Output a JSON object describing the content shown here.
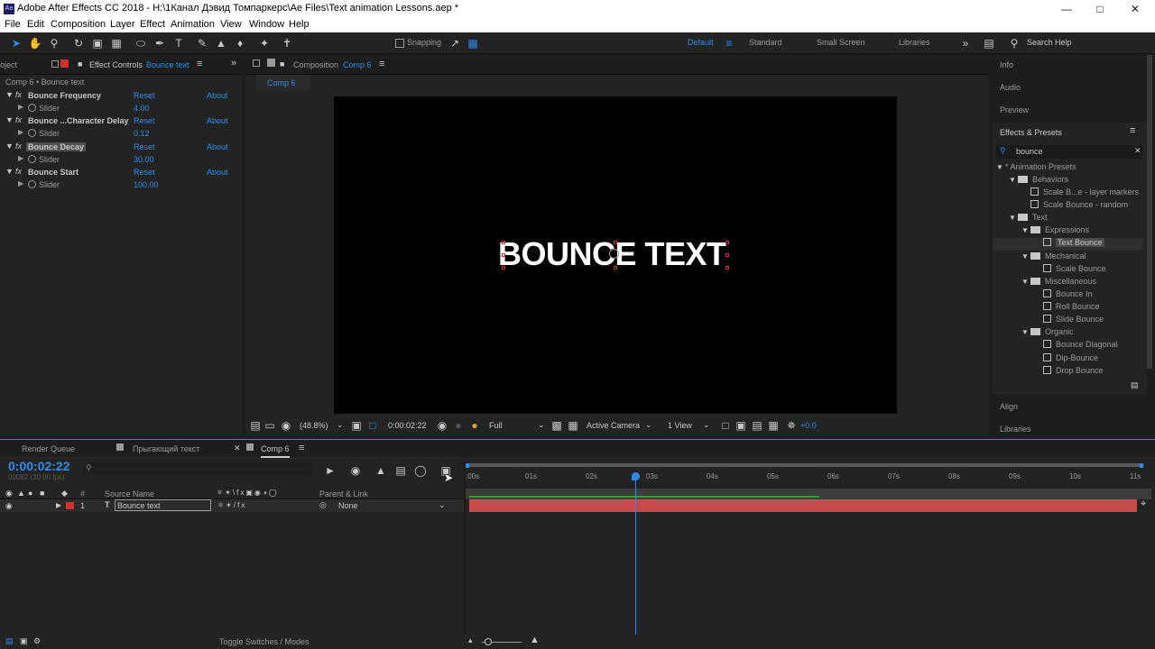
{
  "window": {
    "title": "Adobe After Effects CC 2018 - H:\\1Канал Дэвид Томпаркерс\\Ae Files\\Text animation Lessons.aep *",
    "app_icon": "Ae"
  },
  "menu": [
    "File",
    "Edit",
    "Composition",
    "Layer",
    "Effect",
    "Animation",
    "View",
    "Window",
    "Help"
  ],
  "toolbar": {
    "snapping_label": "Snapping",
    "workspaces": [
      "Default",
      "Standard",
      "Small Screen",
      "Libraries"
    ],
    "active_workspace": "Default",
    "search_help": "Search Help"
  },
  "left_panel": {
    "project_tab": "oject",
    "effect_controls_label": "Effect Controls",
    "effect_controls_layer": "Bounce text",
    "breadcrumb": "Comp 6 • Bounce text",
    "effects": [
      {
        "name": "Bounce Frequency",
        "reset": "Reset",
        "about": "About",
        "slider_label": "Slider",
        "value": "4.00"
      },
      {
        "name": "Bounce ...Character Delay",
        "reset": "Reset",
        "about": "About",
        "slider_label": "Slider",
        "value": "0.12"
      },
      {
        "name": "Bounce Decay",
        "reset": "Reset",
        "about": "About",
        "slider_label": "Slider",
        "value": "30.00"
      },
      {
        "name": "Bounce Start",
        "reset": "Reset",
        "about": "About",
        "slider_label": "Slider",
        "value": "100.00"
      }
    ]
  },
  "composition": {
    "panel_label": "Composition",
    "comp_name": "Comp 6",
    "tab": "Comp 6",
    "text_layer": "BOUNCE TEXT",
    "zoom": "(48.8%)",
    "timecode": "0:00:02:22",
    "resolution": "Full",
    "camera": "Active Camera",
    "views": "1 View",
    "exposure": "+0.0"
  },
  "right_panel": {
    "panels": [
      "Info",
      "Audio",
      "Preview"
    ],
    "effects_presets_title": "Effects & Presets",
    "search_value": "bounce",
    "tree": {
      "root": "* Animation Presets",
      "behaviors": "Behaviors",
      "behaviors_items": [
        "Scale B...e - layer markers",
        "Scale Bounce - random"
      ],
      "text": "Text",
      "expressions": "Expressions",
      "expressions_items": [
        "Text Bounce"
      ],
      "mechanical": "Mechanical",
      "mechanical_items": [
        "Scale Bounce"
      ],
      "miscellaneous": "Miscellaneous",
      "miscellaneous_items": [
        "Bounce In",
        "Roll Bounce",
        "Slide Bounce"
      ],
      "organic": "Organic",
      "organic_items": [
        "Bounce Diagonal",
        "Dip-Bounce",
        "Drop Bounce"
      ]
    },
    "align": "Align",
    "libraries": "Libraries"
  },
  "timeline": {
    "tabs": [
      "Render Queue",
      "Прыгающий текст",
      "Comp 6"
    ],
    "active_tab": "Comp 6",
    "timecode": "0:00:02:22",
    "frame_info": "00082 (30.00 fps)",
    "col_source_name": "Source Name",
    "col_parent": "Parent & Link",
    "layer_number": "1",
    "layer_name": "Bounce text",
    "parent_value": "None",
    "ruler": [
      ":00s",
      "01s",
      "02s",
      "03s",
      "04s",
      "05s",
      "06s",
      "07s",
      "08s",
      "09s",
      "10s",
      "11s"
    ],
    "toggle_label": "Toggle Switches / Modes",
    "playhead_seconds": 2.92
  },
  "colors": {
    "accent": "#2d8ceb",
    "layer_bar": "#c84a4a",
    "label_red": "#d22e2e"
  }
}
